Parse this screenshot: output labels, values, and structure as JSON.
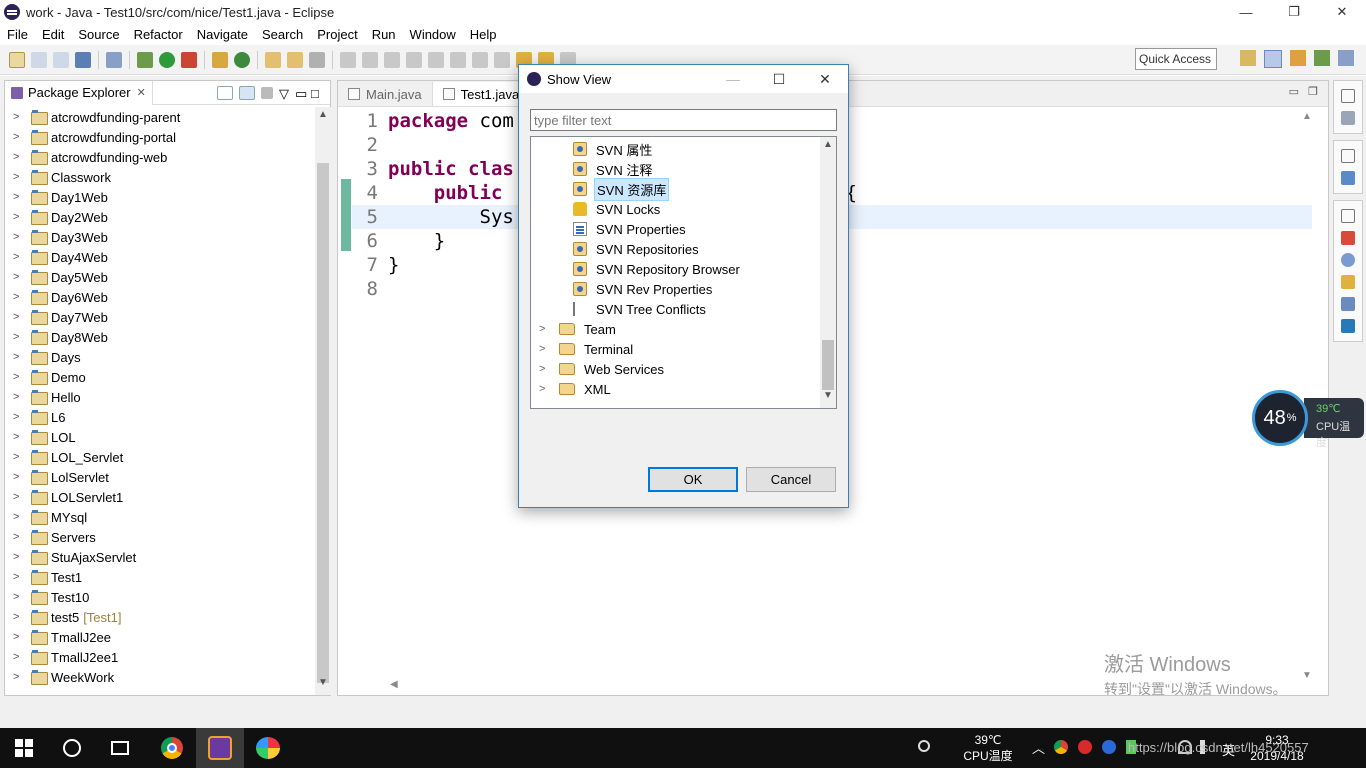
{
  "window": {
    "title": "work - Java - Test10/src/com/nice/Test1.java - Eclipse",
    "minimize": "—",
    "maximize": "❐",
    "close": "✕"
  },
  "menu": [
    "File",
    "Edit",
    "Source",
    "Refactor",
    "Navigate",
    "Search",
    "Project",
    "Run",
    "Window",
    "Help"
  ],
  "toolbar": {
    "quick_access": "Quick Access"
  },
  "package_explorer": {
    "title": "Package Explorer",
    "close": "✕",
    "projects": [
      {
        "name": "atcrowdfunding-parent",
        "decor": ""
      },
      {
        "name": "atcrowdfunding-portal",
        "decor": ""
      },
      {
        "name": "atcrowdfunding-web",
        "decor": ""
      },
      {
        "name": "Classwork",
        "decor": ""
      },
      {
        "name": "Day1Web",
        "decor": ""
      },
      {
        "name": "Day2Web",
        "decor": ""
      },
      {
        "name": "Day3Web",
        "decor": ""
      },
      {
        "name": "Day4Web",
        "decor": ""
      },
      {
        "name": "Day5Web",
        "decor": ""
      },
      {
        "name": "Day6Web",
        "decor": ""
      },
      {
        "name": "Day7Web",
        "decor": ""
      },
      {
        "name": "Day8Web",
        "decor": ""
      },
      {
        "name": "Days",
        "decor": ""
      },
      {
        "name": "Demo",
        "decor": ""
      },
      {
        "name": "Hello",
        "decor": ""
      },
      {
        "name": "L6",
        "decor": ""
      },
      {
        "name": "LOL",
        "decor": ""
      },
      {
        "name": "LOL_Servlet",
        "decor": ""
      },
      {
        "name": "LolServlet",
        "decor": ""
      },
      {
        "name": "LOLServlet1",
        "decor": ""
      },
      {
        "name": "MYsql",
        "decor": ""
      },
      {
        "name": "Servers",
        "decor": ""
      },
      {
        "name": "StuAjaxServlet",
        "decor": ""
      },
      {
        "name": "Test1",
        "decor": ""
      },
      {
        "name": "Test10",
        "decor": ""
      },
      {
        "name": "test5",
        "decor": "[Test1]"
      },
      {
        "name": "TmallJ2ee",
        "decor": ""
      },
      {
        "name": "TmallJ2ee1",
        "decor": ""
      },
      {
        "name": "WeekWork",
        "decor": ""
      }
    ]
  },
  "editor": {
    "tabs": [
      {
        "label": "Main.java",
        "active": false
      },
      {
        "label": "Test1.java",
        "active": true
      }
    ],
    "lines": [
      {
        "n": "1",
        "kw": "package",
        "rest": " com"
      },
      {
        "n": "2",
        "kw": "",
        "rest": ""
      },
      {
        "n": "3",
        "kw": "public clas",
        "rest": ""
      },
      {
        "n": "4",
        "kw": "    public",
        "rest": "                         rgs) {"
      },
      {
        "n": "5",
        "kw": "",
        "rest": "        Sys"
      },
      {
        "n": "6",
        "kw": "",
        "rest": "    }"
      },
      {
        "n": "7",
        "kw": "",
        "rest": "}"
      },
      {
        "n": "8",
        "kw": "",
        "rest": ""
      }
    ]
  },
  "dialog": {
    "title": "Show View",
    "filter_placeholder": "type filter text",
    "items": [
      {
        "label": "SVN 属性",
        "icon": "svn-properties-icon",
        "level": 2,
        "selected": false,
        "expandable": false
      },
      {
        "label": "SVN 注释",
        "icon": "svn-annotate-icon",
        "level": 2,
        "selected": false,
        "expandable": false
      },
      {
        "label": "SVN 资源库",
        "icon": "svn-repository-icon",
        "level": 2,
        "selected": true,
        "expandable": false
      },
      {
        "label": "SVN Locks",
        "icon": "lock-icon",
        "level": 2,
        "selected": false,
        "expandable": false
      },
      {
        "label": "SVN Properties",
        "icon": "properties-icon",
        "level": 2,
        "selected": false,
        "expandable": false
      },
      {
        "label": "SVN Repositories",
        "icon": "svn-repository-icon",
        "level": 2,
        "selected": false,
        "expandable": false
      },
      {
        "label": "SVN Repository Browser",
        "icon": "svn-browser-icon",
        "level": 2,
        "selected": false,
        "expandable": false
      },
      {
        "label": "SVN Rev Properties",
        "icon": "svn-rev-properties-icon",
        "level": 2,
        "selected": false,
        "expandable": false
      },
      {
        "label": "SVN Tree Conflicts",
        "icon": "tree-conflicts-icon",
        "level": 2,
        "selected": false,
        "expandable": false
      },
      {
        "label": "Team",
        "icon": "folder-icon",
        "level": 1,
        "selected": false,
        "expandable": true
      },
      {
        "label": "Terminal",
        "icon": "folder-icon",
        "level": 1,
        "selected": false,
        "expandable": true
      },
      {
        "label": "Web Services",
        "icon": "folder-icon",
        "level": 1,
        "selected": false,
        "expandable": true
      },
      {
        "label": "XML",
        "icon": "folder-icon",
        "level": 1,
        "selected": false,
        "expandable": true
      }
    ],
    "ok": "OK",
    "cancel": "Cancel"
  },
  "cpu_widget": {
    "percent": "48",
    "percent_sign": "%",
    "temp": "39℃",
    "label": "CPU温度"
  },
  "watermark": {
    "line1": "激活 Windows",
    "line2": "转到\"设置\"以激活 Windows。"
  },
  "taskbar": {
    "cpu_temp": "39℃",
    "cpu_label": "CPU温度",
    "ime": "英",
    "url_overlay": "https://blog.csdn.net/lh4520557",
    "time": "9:33",
    "date": "2019/4/18"
  }
}
